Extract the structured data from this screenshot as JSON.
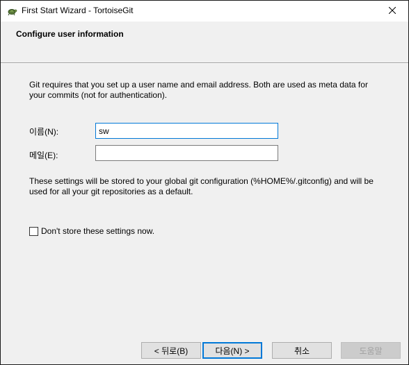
{
  "window": {
    "title": "First Start Wizard - TortoiseGit",
    "app_icon": "tortoise-icon",
    "close_icon": "close-icon"
  },
  "header": {
    "title": "Configure user information"
  },
  "content": {
    "intro": "Git requires that you set up a user name and email address. Both are used as meta data for your commits (not for authentication).",
    "name_label": "이름(N):",
    "name_value": "sw",
    "email_label": "메일(E):",
    "email_value": "",
    "note": "These settings will be stored to your global git configuration (%HOME%/.gitconfig) and will be used for all your git repositories as a default.",
    "dont_store_label": "Don't store these settings now.",
    "dont_store_checked": false
  },
  "footer": {
    "back_label": "< 뒤로(B)",
    "next_label": "다음(N) >",
    "cancel_label": "취소",
    "help_label": "도움말"
  },
  "colors": {
    "accent": "#0078d7",
    "background": "#f0f0f0"
  }
}
